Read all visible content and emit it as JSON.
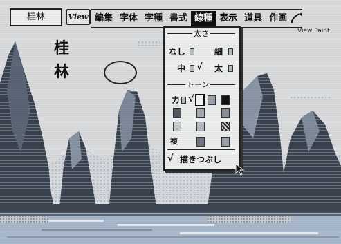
{
  "toolbar": {
    "title_field": "桂林",
    "view_button": "View",
    "menu": [
      "編集",
      "字体",
      "字種",
      "書式",
      "線種",
      "表示",
      "道具",
      "作画"
    ],
    "active_index": 4,
    "app_title": "View Paint"
  },
  "canvas": {
    "text_line1": "桂",
    "text_line2": "林"
  },
  "dropdown": {
    "thickness_title": "太さ",
    "thickness_options": {
      "none": "なし",
      "thin": "細",
      "medium": "中",
      "thick": "太"
    },
    "tone_title": "トーン",
    "tone_custom": "カ",
    "tone_copy": "複",
    "fill_label": "描きつぶし",
    "check_mark": "√"
  },
  "colors": {
    "active_menu_bg": "#111111",
    "sky": "#d9dbdc",
    "mountain_dark": "#4d5560",
    "mountain_mid": "#7c8a9a",
    "water": "#a9b9cc"
  },
  "icons": [
    "brush-icon",
    "mouse-cursor-icon"
  ]
}
